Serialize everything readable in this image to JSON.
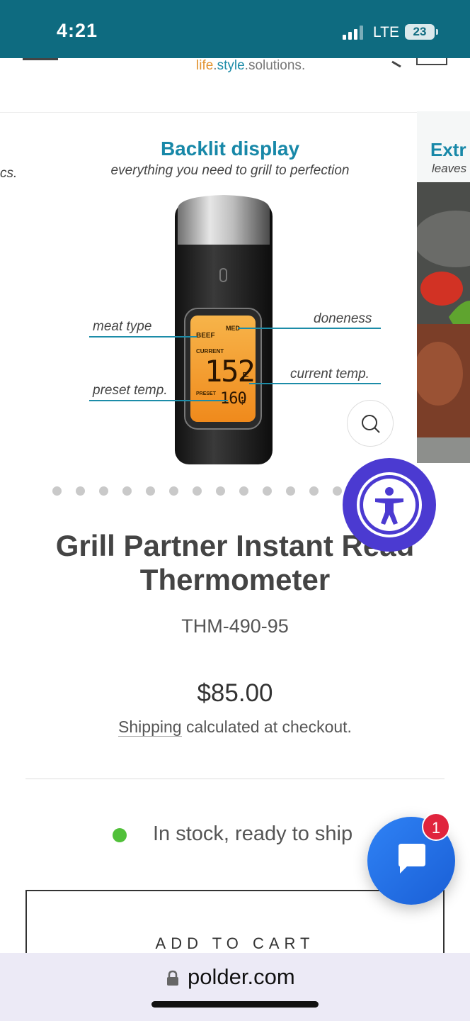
{
  "status_bar": {
    "time": "4:21",
    "network": "LTE",
    "battery": "23"
  },
  "header": {
    "tagline_parts": [
      "life",
      ".",
      "style",
      ".",
      "solutions",
      "."
    ],
    "menu_icon": "hamburger-icon",
    "search_icon": "search-icon",
    "cart_icon": "cart-icon"
  },
  "carousel": {
    "prev_slide_text": "cs.",
    "heading": "Backlit display",
    "subheading": "everything you need to grill to perfection",
    "callouts": {
      "meat_type": "meat type",
      "doneness": "doneness",
      "current_temp": "current temp.",
      "preset_temp": "preset temp."
    },
    "display": {
      "meat": "BEEF",
      "doneness": "MED",
      "current_label": "CURRENT",
      "current_value": "152",
      "unit": "F",
      "preset_label": "PRESET",
      "preset_value": "160"
    },
    "next_slide_title": "Extr",
    "next_slide_sub": "leaves",
    "dot_count": 13,
    "active_dot": 0
  },
  "product": {
    "title": "Grill Partner Instant Read Thermometer",
    "sku": "THM-490-95",
    "price": "$85.00",
    "shipping_link": "Shipping",
    "shipping_rest": " calculated at checkout.",
    "stock": "In stock, ready to ship",
    "add_to_cart": "ADD TO CART"
  },
  "widgets": {
    "chat_badge": "1",
    "accessibility_icon": "accessibility-icon",
    "chat_icon": "chat-bubble-icon"
  },
  "browser": {
    "url": "polder.com"
  },
  "colors": {
    "status_bar": "#0e6b80",
    "heading_teal": "#1888a8",
    "accessibility": "#4b3ad1",
    "chat": "#2f82f5",
    "stock_green": "#51c03a",
    "badge_red": "#e0243d"
  }
}
